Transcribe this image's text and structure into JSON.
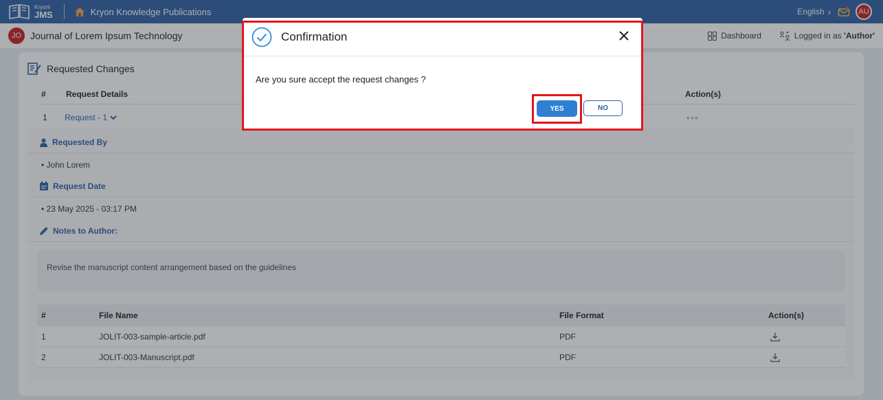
{
  "topbar": {
    "logo_small": "Kryoni",
    "logo_big": "JMS",
    "publisher": "Kryon Knowledge Publications",
    "language": "English",
    "user_initials": "AU"
  },
  "subbar": {
    "journal_initials": "JO",
    "journal_title": "Journal of Lorem Ipsum Technology",
    "dashboard_label": "Dashboard",
    "logged_prefix": "Logged in as ",
    "logged_role": "'Author'"
  },
  "panel": {
    "title": "Requested Changes",
    "headers": {
      "num": "#",
      "details": "Request Details",
      "actions": "Action(s)"
    },
    "row": {
      "num": "1",
      "label": "Request - 1",
      "actions": "◦◦◦"
    },
    "requested_by_title": "Requested By",
    "requested_by": "John Lorem",
    "request_date_title": "Request Date",
    "request_date": "23 May 2025 - 03:17 PM",
    "notes_title": "Notes to Author:",
    "notes": "Revise the manuscript content arrangement based on the guidelines",
    "files_headers": {
      "num": "#",
      "name": "File Name",
      "format": "File Format",
      "actions": "Action(s)"
    },
    "files": [
      {
        "num": "1",
        "name": "JOLIT-003-sample-article.pdf",
        "format": "PDF"
      },
      {
        "num": "2",
        "name": "JOLIT-003-Manuscript.pdf",
        "format": "PDF"
      }
    ]
  },
  "modal": {
    "title": "Confirmation",
    "message": "Are you sure accept the request changes ?",
    "yes_label": "YES",
    "no_label": "NO"
  },
  "colors": {
    "brand": "#2f62a5",
    "accent_button": "#2f7fd2",
    "avatar": "#c81f1f",
    "highlight": "#e4151b"
  }
}
